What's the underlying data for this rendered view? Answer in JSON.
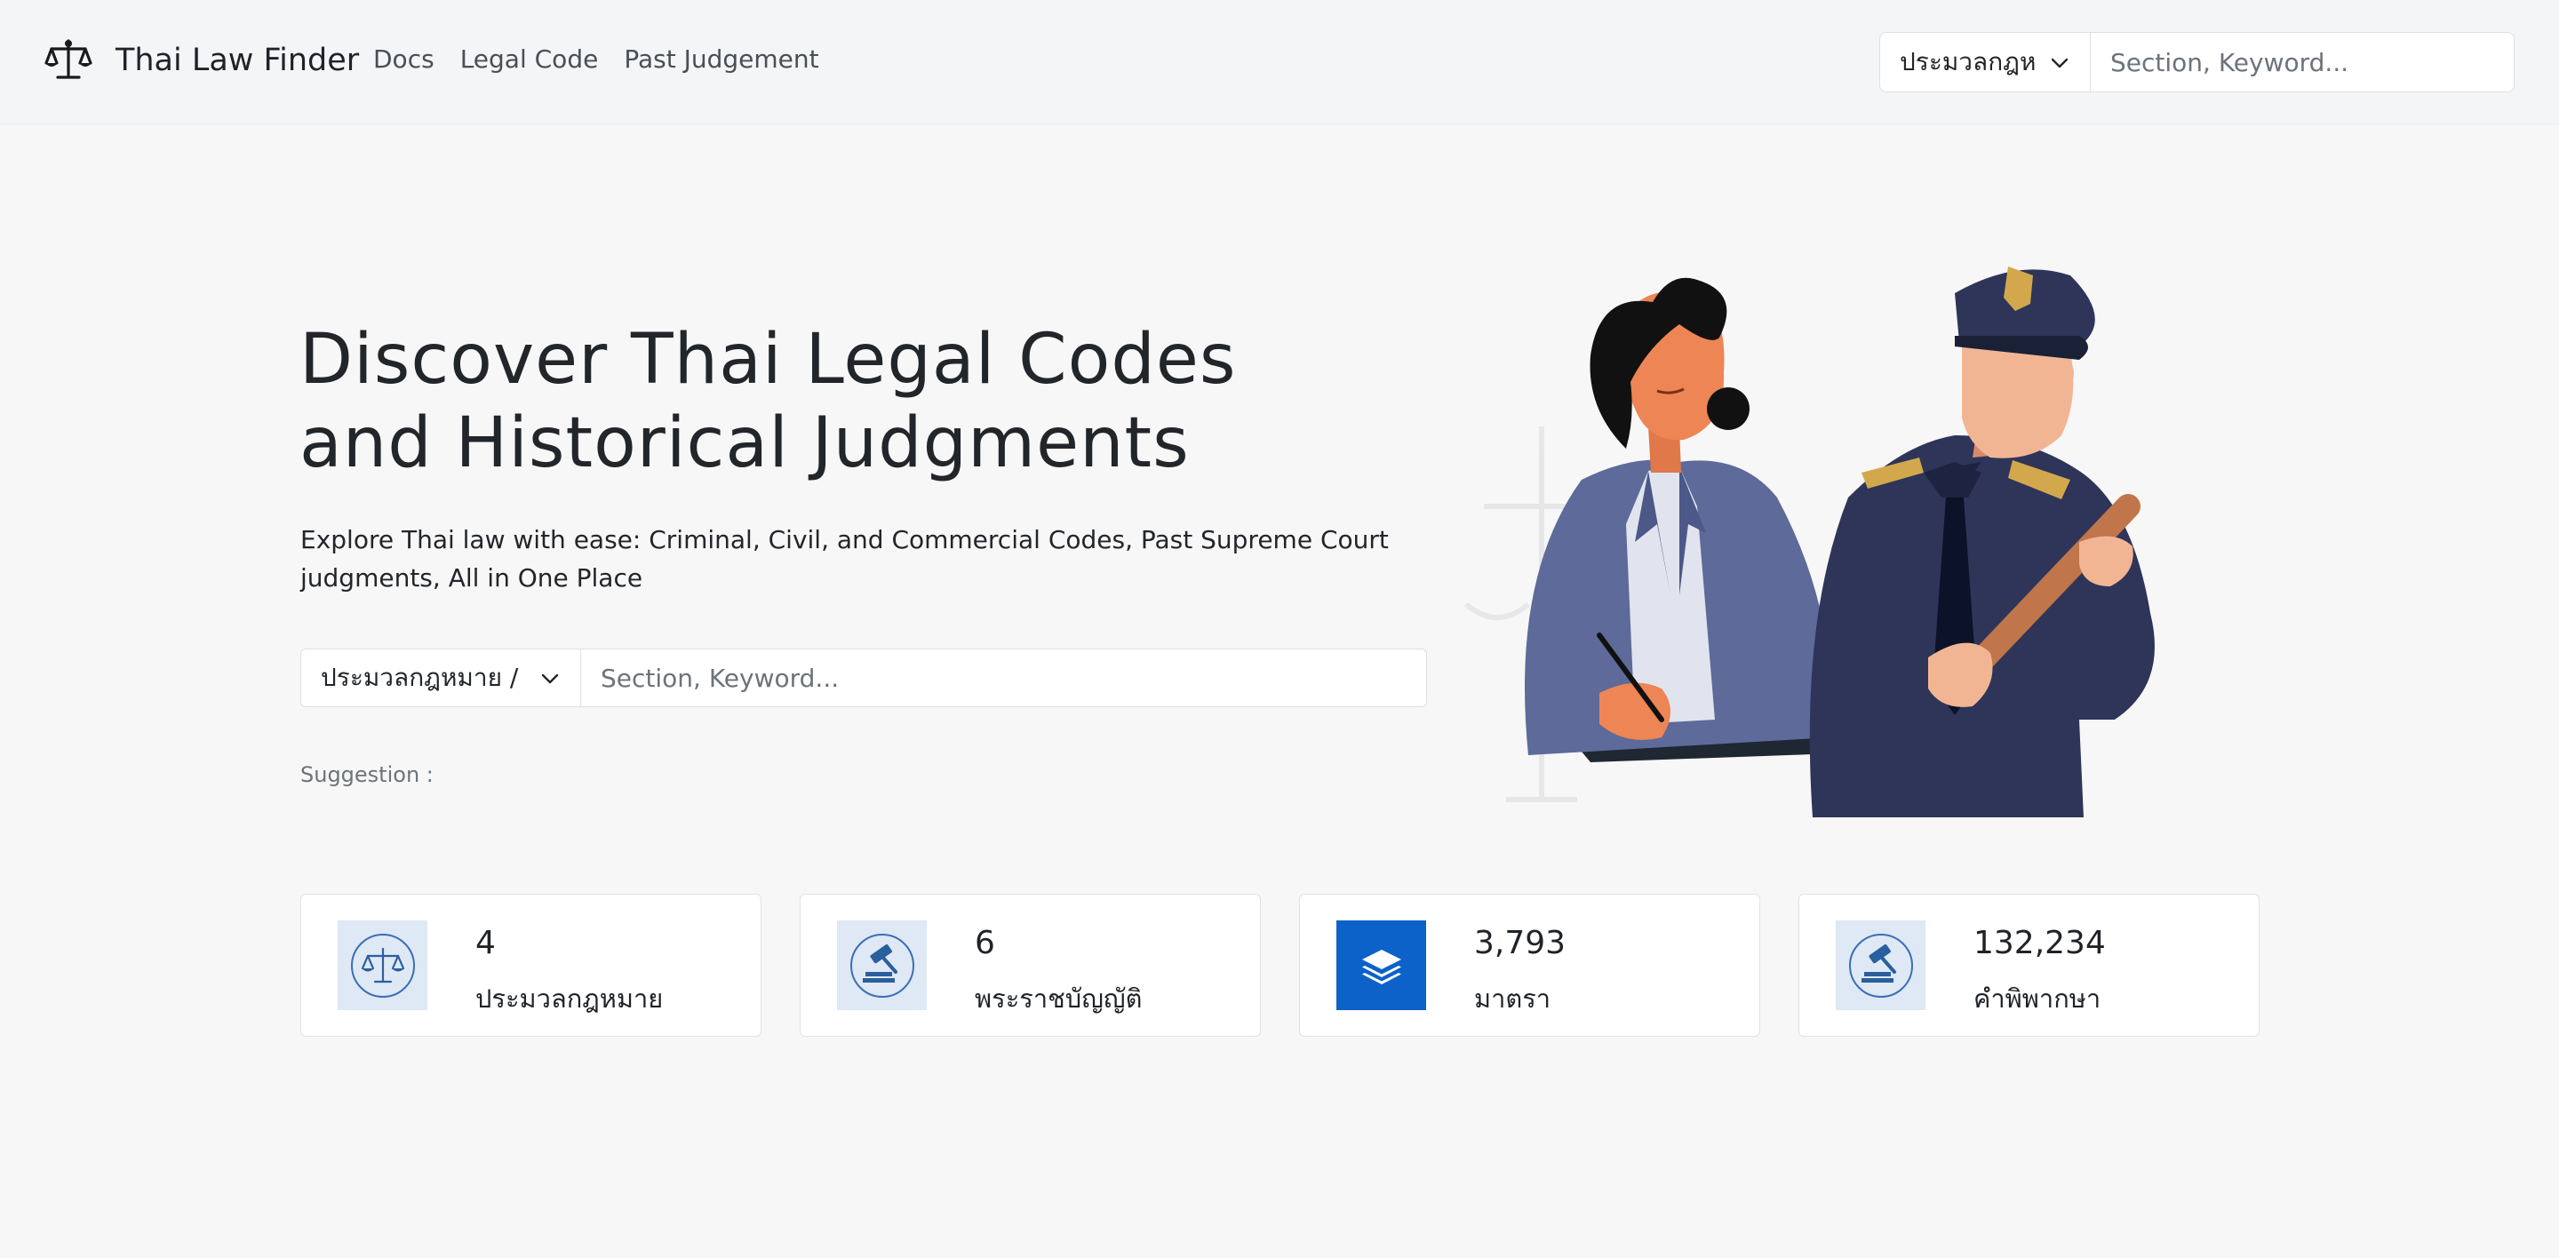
{
  "header": {
    "brand": "Thai Law Finder",
    "brand_icon": "scales-of-justice-icon",
    "nav": [
      "Docs",
      "Legal Code",
      "Past Judgement"
    ],
    "search": {
      "select_value": "ประมวลกฎห",
      "placeholder": "Section, Keyword..."
    }
  },
  "hero": {
    "title": "Discover Thai Legal Codes and Historical Judgments",
    "subtitle": "Explore Thai law with ease: Criminal, Civil, and Commercial Codes, Past Supreme Court judgments, All in One Place",
    "search": {
      "select_value": "ประมวลกฎหมาย / ประมวลกฎหมาย",
      "placeholder": "Section, Keyword..."
    },
    "suggestion_label": "Suggestion :"
  },
  "stats": [
    {
      "value": "4",
      "label": "ประมวลกฎหมาย",
      "icon": "scales-icon"
    },
    {
      "value": "6",
      "label": "พระราชบัญญัติ",
      "icon": "gavel-icon"
    },
    {
      "value": "3,793",
      "label": "มาตรา",
      "icon": "layers-icon"
    },
    {
      "value": "132,234",
      "label": "คำพิพากษา",
      "icon": "gavel-icon"
    }
  ],
  "colors": {
    "accent": "#0d62c9",
    "icon_bg": "#dfe8f5",
    "background": "#f7f7f7"
  }
}
